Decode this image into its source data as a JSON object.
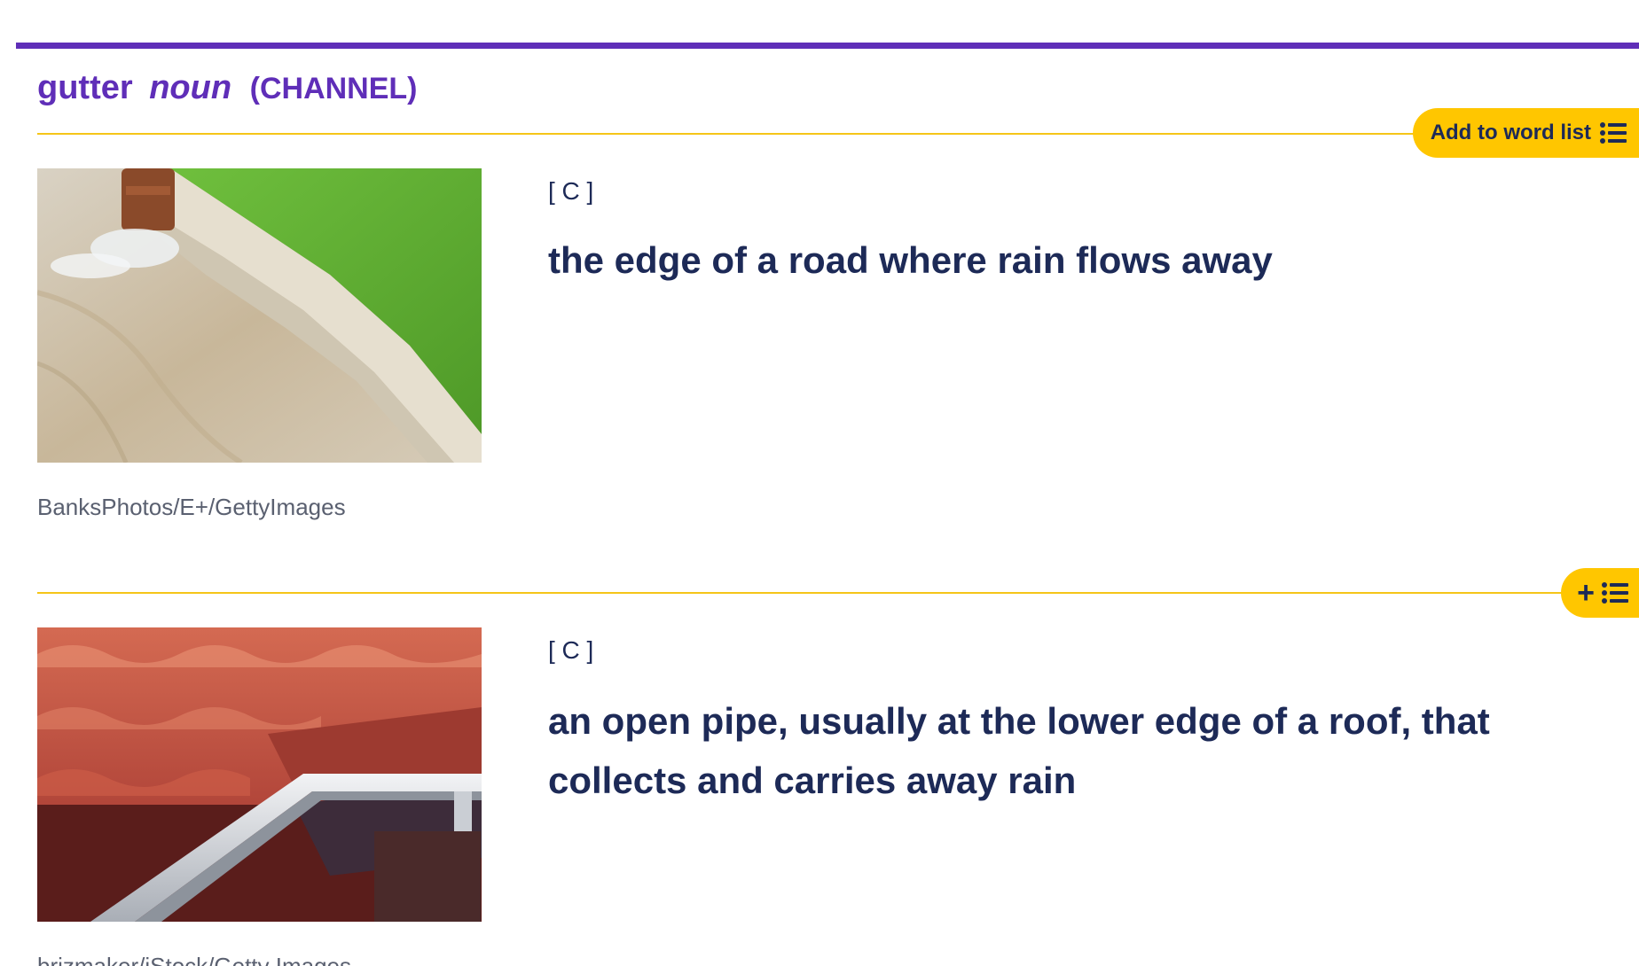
{
  "entry": {
    "word": "gutter",
    "pos": "noun",
    "guideword": "(CHANNEL)"
  },
  "wordlist": {
    "label": "Add to word list",
    "icon": "list-icon",
    "compact_icon": "plus-list-icon"
  },
  "senses": [
    {
      "grammar": "[ C ]",
      "definition": "the edge of a road where rain flows away",
      "image_credit": "BanksPhotos/E+/GettyImages",
      "image_subject": "street gutter with running water beside grass verge"
    },
    {
      "grammar": "[ C ]",
      "definition": "an open pipe, usually at the lower edge of a roof, that collects and carries away rain",
      "image_credit": "brizmaker/iStock/Getty Images",
      "image_subject": "red metal roof tiles with grey rain gutter"
    }
  ],
  "colors": {
    "brand_purple": "#5f2eb8",
    "accent_yellow": "#ffc600",
    "text_navy": "#1d2a57"
  }
}
